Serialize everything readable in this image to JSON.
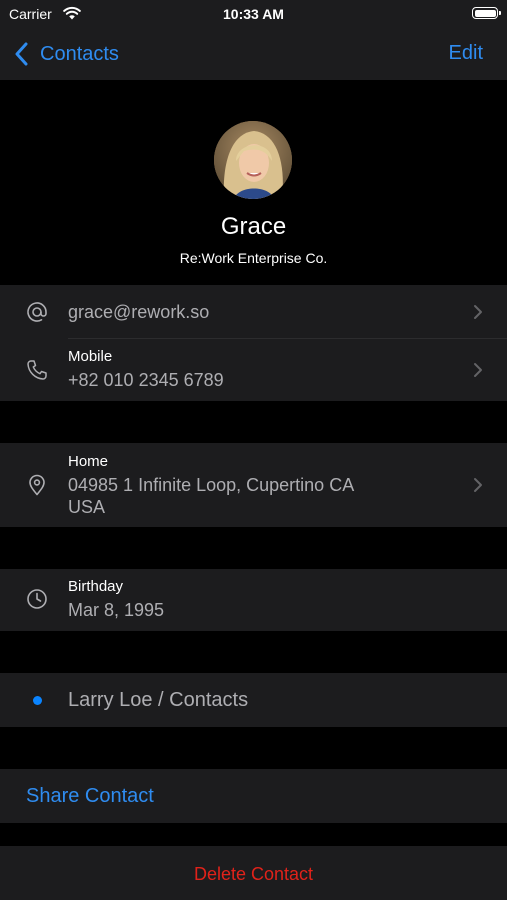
{
  "status_bar": {
    "carrier": "Carrier",
    "time": "10:33 AM"
  },
  "nav": {
    "back_label": "Contacts",
    "edit_label": "Edit"
  },
  "contact": {
    "name": "Grace",
    "company": "Re:Work Enterprise Co."
  },
  "email": {
    "value": "grace@rework.so"
  },
  "phone": {
    "label": "Mobile",
    "value": "+82 010 2345 6789"
  },
  "address": {
    "label": "Home",
    "line1": "04985 1 Infinite Loop, Cupertino CA",
    "line2": "USA"
  },
  "birthday": {
    "label": "Birthday",
    "value": "Mar 8, 1995"
  },
  "list": {
    "value": "Larry Loe / Contacts"
  },
  "actions": {
    "share_label": "Share Contact",
    "delete_label": "Delete Contact"
  },
  "colors": {
    "accent": "#2f8cf0",
    "destructive": "#e0221a",
    "cell_background": "#1c1c1e",
    "page_background": "#000000"
  }
}
